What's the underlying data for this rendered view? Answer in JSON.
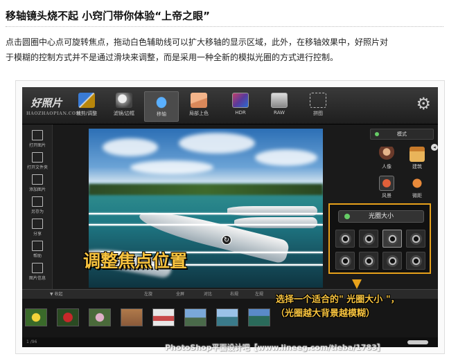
{
  "article": {
    "title": "移轴镜头烧不起 小窍门带你体验“上帝之眼”",
    "paragraph_line1": "点击圆圈中心点可旋转焦点，拖动白色辅助线可以扩大移轴的显示区域，此外，在移轴效果中，好照片对",
    "paragraph_line2": "于模糊的控制方式并不是通过滑块来调整，而是采用一种全新的模拟光圈的方式进行控制。"
  },
  "app": {
    "logo": "好照片",
    "logo_sub": "HAOZHAOPIAN.COM",
    "toolbar": [
      {
        "label": "裁剪/调整",
        "icon": "crop-adjust-icon",
        "active": false
      },
      {
        "label": "滤镜/边框",
        "icon": "filter-frame-icon",
        "active": false
      },
      {
        "label": "移轴",
        "icon": "tilt-shift-icon",
        "active": true
      },
      {
        "label": "局部上色",
        "icon": "local-color-icon",
        "active": false
      },
      {
        "label": "HDR",
        "icon": "hdr-icon",
        "active": false
      },
      {
        "label": "RAW",
        "icon": "raw-icon",
        "active": false
      },
      {
        "label": "拼图",
        "icon": "collage-icon",
        "active": false
      }
    ],
    "sidebar": [
      {
        "label": "打开图片",
        "icon": "open-image-icon"
      },
      {
        "label": "打开文件夹",
        "icon": "open-folder-icon"
      },
      {
        "label": "添加图片",
        "icon": "add-image-icon"
      },
      {
        "label": "另存为",
        "icon": "save-as-icon"
      },
      {
        "label": "分享",
        "icon": "share-icon"
      },
      {
        "label": "帮助",
        "icon": "help-icon"
      },
      {
        "label": "图片信息",
        "icon": "image-info-icon"
      }
    ],
    "overlay_text": "调整焦点位置",
    "mode_panel": {
      "header": "模式",
      "items": [
        {
          "label": "人像",
          "icon": "portrait-icon"
        },
        {
          "label": "建筑",
          "icon": "building-icon"
        },
        {
          "label": "风景",
          "icon": "landscape-icon"
        },
        {
          "label": "微距",
          "icon": "macro-icon"
        }
      ]
    },
    "aperture_panel": {
      "header": "光圈大小",
      "selected_index": 2,
      "count": 8
    },
    "controls": {
      "collapse": "▼ 收起",
      "rotate_left": "左旋",
      "fullscreen": "全屏",
      "compare": "对比",
      "rotate_right": "右规",
      "back": "左规"
    },
    "callout": {
      "line1": "选择一个适合的\" 光圈大小 \"，",
      "line2": "（光圈越大背景越模糊）"
    },
    "status": "1 /96"
  },
  "watermark": "PhotoShop平面设计吧【www.lineeg.com/tieba/1783】"
}
